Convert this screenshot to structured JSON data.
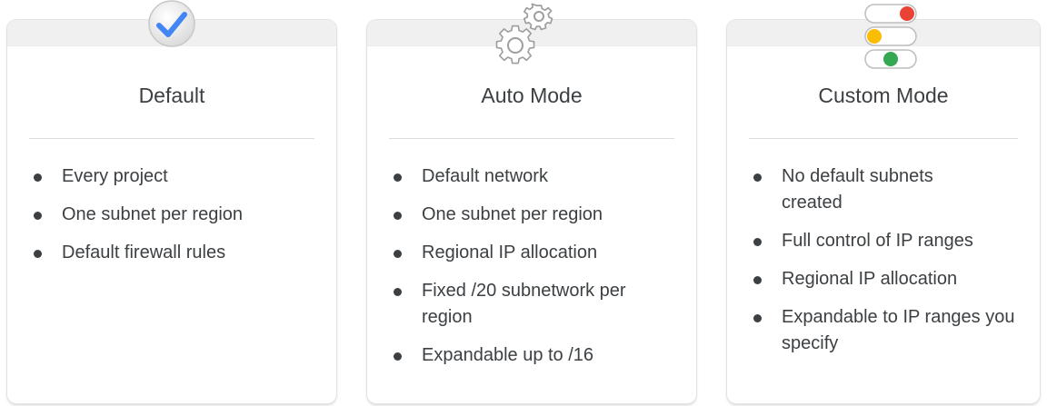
{
  "cards": [
    {
      "icon": "checkmark-icon",
      "title": "Default",
      "items": [
        "Every project",
        "One subnet per region",
        "Default firewall rules"
      ]
    },
    {
      "icon": "gears-icon",
      "title": "Auto Mode",
      "items": [
        "Default network",
        "One subnet per region",
        "Regional IP allocation",
        "Fixed /20 subnetwork per region",
        "Expandable up to /16"
      ]
    },
    {
      "icon": "traffic-light-toggles-icon",
      "title": "Custom Mode",
      "items": [
        "No default subnets created",
        "Full control of IP ranges",
        "Regional IP allocation",
        "Expandable to IP ranges you specify"
      ]
    }
  ],
  "colors": {
    "check_blue": "#4285f4",
    "red": "#ea4335",
    "yellow": "#fbbc04",
    "green": "#34a853"
  }
}
